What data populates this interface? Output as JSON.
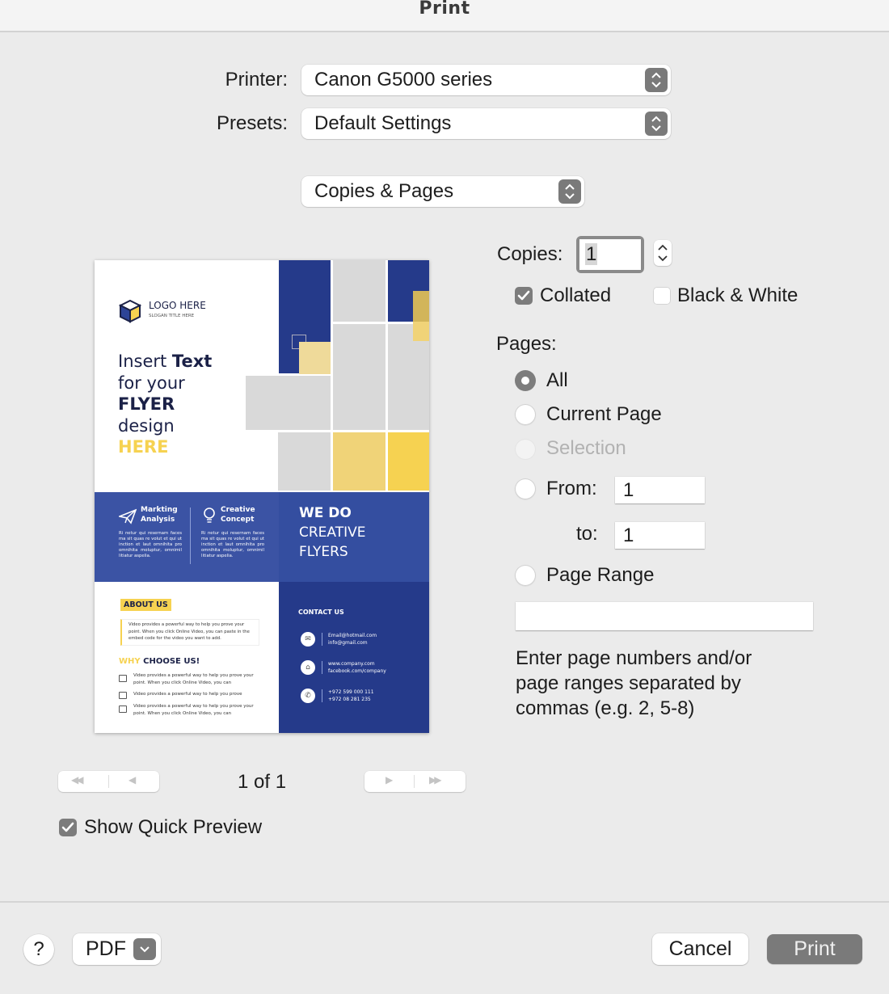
{
  "window": {
    "title": "Print"
  },
  "printer": {
    "label": "Printer:",
    "value": "Canon G5000 series"
  },
  "presets": {
    "label": "Presets:",
    "value": "Default Settings"
  },
  "section_menu": {
    "value": "Copies & Pages"
  },
  "copies": {
    "label": "Copies:",
    "value": "1",
    "collated": {
      "label": "Collated",
      "checked": true
    },
    "black_white": {
      "label": "Black & White",
      "checked": false
    }
  },
  "pages": {
    "label": "Pages:",
    "options": [
      {
        "label": "All",
        "selected": true,
        "enabled": true
      },
      {
        "label": "Current Page",
        "selected": false,
        "enabled": true
      },
      {
        "label": "Selection",
        "selected": false,
        "enabled": false
      },
      {
        "label": "From:",
        "selected": false,
        "enabled": true
      },
      {
        "label": "Page Range",
        "selected": false,
        "enabled": true
      }
    ],
    "from_value": "1",
    "to_label": "to:",
    "to_value": "1",
    "range_value": "",
    "help_text_lines": [
      "Enter page numbers and/or",
      "page ranges separated by",
      "commas (e.g. 2, 5-8)"
    ]
  },
  "preview": {
    "page_indicator": "1 of 1",
    "first_icon": "first-page-icon",
    "prev_icon": "previous-page-icon",
    "next_icon": "next-page-icon",
    "last_icon": "last-page-icon",
    "show_quick_preview": {
      "label": "Show Quick Preview",
      "checked": true
    },
    "flyer": {
      "logo_title": "LOGO HERE",
      "logo_slogan": "SLOGAN TITLE HERE",
      "headline": {
        "line1_regular": "Insert ",
        "line1_bold": "Text",
        "line2": "for your",
        "line3": "FLYER",
        "line4": "design",
        "line5": "HERE"
      },
      "features": [
        {
          "icon": "paper-plane-icon",
          "title_line1": "Markting",
          "title_line2": "Analysis",
          "body": "Ri netur qui resernam faces ma sit quas re volut et qui ut inction et laut omnihita pro omnihita moluptur, omnimil litiatur aspelia."
        },
        {
          "icon": "lightbulb-icon",
          "title_line1": "Creative",
          "title_line2": "Concept",
          "body": "Ri netur qui resernam faces ma sit quas re volut et qui ut inction et laut omnihita pro omnihita moluptur, omnimil litiatur aspelia."
        }
      ],
      "slogan": {
        "line1": "WE DO",
        "line2": "CREATIVE",
        "line3": "FLYERS"
      },
      "about": {
        "badge": "ABOUT US",
        "body": "Video provides a powerful way to help you prove your point. When you click Online Video, you can paste in the embed code for the video you want to add."
      },
      "why": {
        "title_accent": "WHY ",
        "title_main": "CHOOSE US!",
        "items": [
          "Video provides a powerful way to help you prove your point. When you click Online Video, you can",
          "Video provides a powerful way to help you prove",
          "Video provides a powerful way to help you prove your point. When you click Online Video, you can"
        ]
      },
      "contact": {
        "title": "CONTACT US",
        "rows": [
          {
            "icon": "email-icon",
            "line1": "Email@hotmail.com",
            "line2": "info@gmail.com"
          },
          {
            "icon": "home-icon",
            "line1": "www.company.com",
            "line2": "facebook.com/company"
          },
          {
            "icon": "phone-icon",
            "line1": "+972 599 000 111",
            "line2": "+972 08 281 235"
          }
        ]
      },
      "colors": {
        "navy": "#253a8a",
        "yellow": "#f6d251",
        "gray": "#d9d9d9"
      }
    }
  },
  "footer": {
    "help_label": "?",
    "pdf_label": "PDF",
    "cancel_label": "Cancel",
    "print_label": "Print"
  }
}
